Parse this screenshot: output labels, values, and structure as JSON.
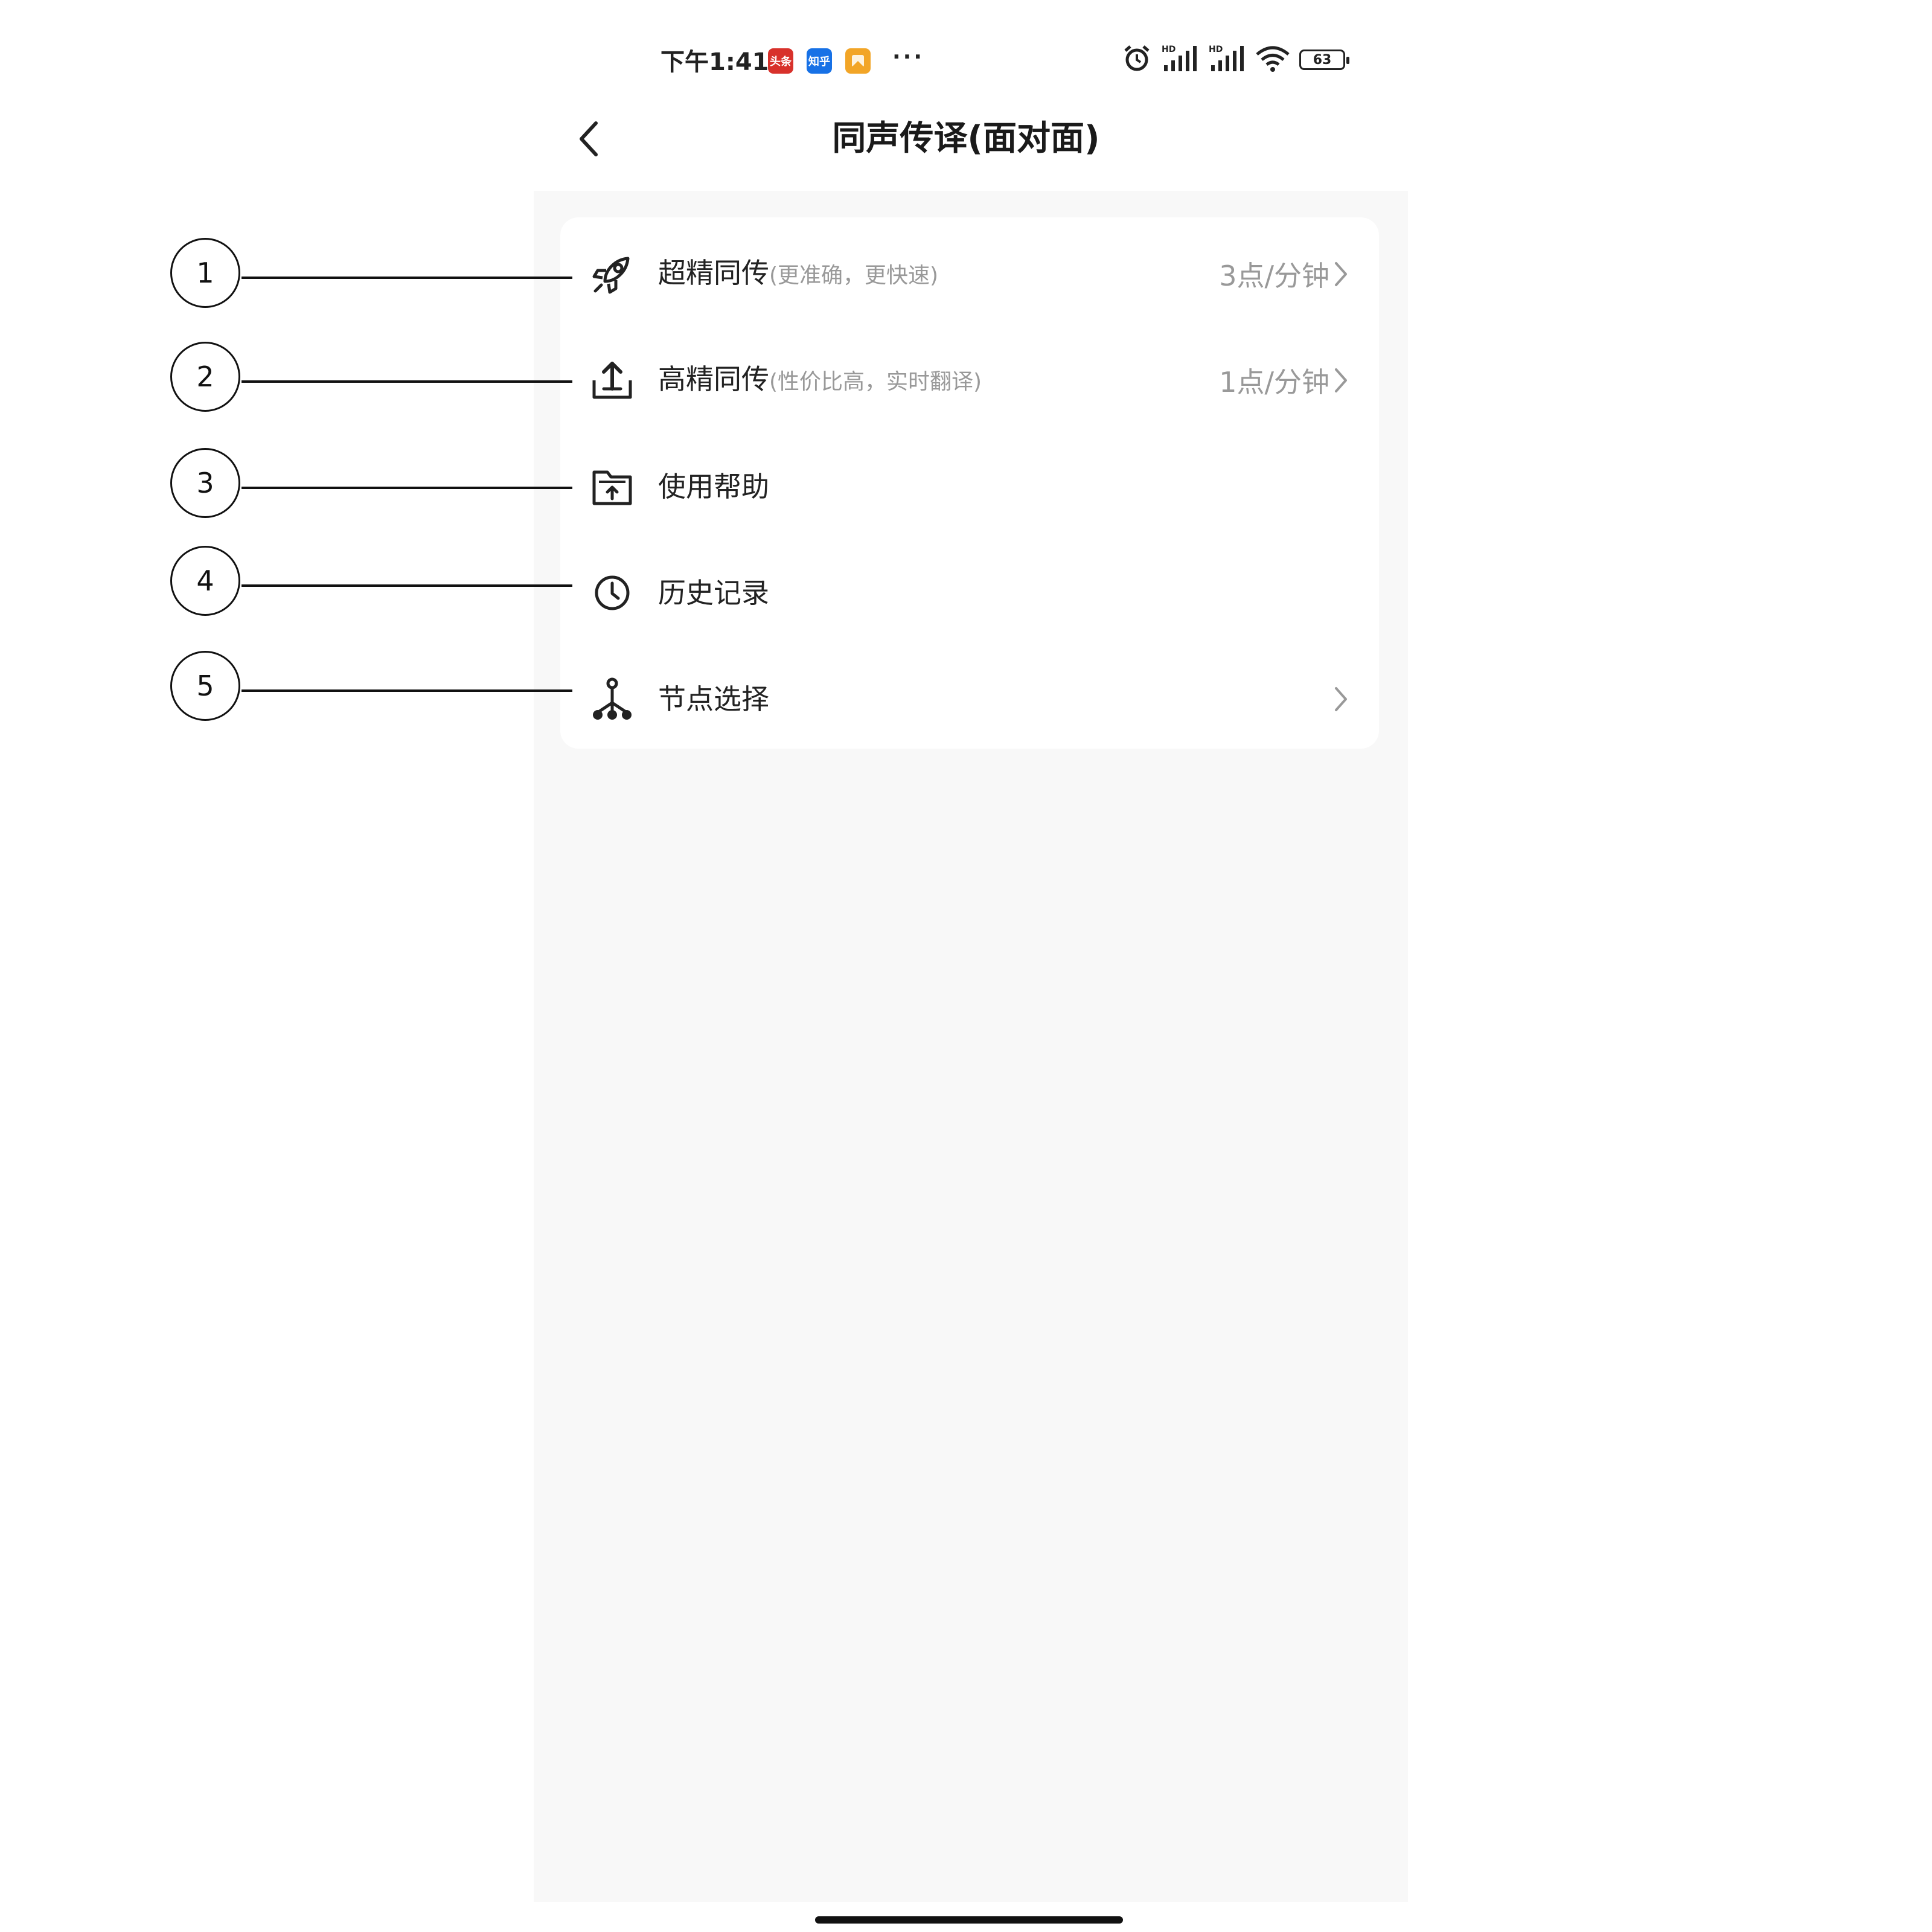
{
  "status_bar": {
    "time": "下午1:41",
    "badges": [
      "头条",
      "知乎",
      ""
    ],
    "dots": "···",
    "battery": "63",
    "icons": [
      "alarm-icon",
      "signal-hd-icon",
      "signal-hd-icon",
      "wifi-icon",
      "battery-icon"
    ]
  },
  "header": {
    "title": "同声传译(面对面)"
  },
  "menu": {
    "items": [
      {
        "label": "超精同传",
        "sub": "(更准确，更快速)",
        "price": "3点/分钟",
        "icon": "rocket-icon"
      },
      {
        "label": "高精同传",
        "sub": "(性价比高，实时翻译)",
        "price": "1点/分钟",
        "icon": "upload-tray-icon"
      },
      {
        "label": "使用帮助",
        "sub": "",
        "price": "",
        "icon": "folder-upload-icon"
      },
      {
        "label": "历史记录",
        "sub": "",
        "price": "",
        "icon": "clock-icon"
      },
      {
        "label": "节点选择",
        "sub": "",
        "price": "",
        "icon": "node-tree-icon"
      }
    ]
  },
  "annotations": [
    "1",
    "2",
    "3",
    "4",
    "5"
  ]
}
